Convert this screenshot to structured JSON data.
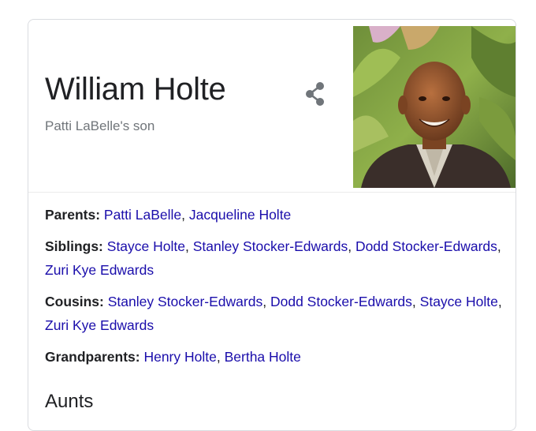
{
  "card": {
    "title": "William Holte",
    "subtitle": "Patti LaBelle's son",
    "share_icon": "share-icon",
    "photo_alt": "William Holte photo"
  },
  "facts": {
    "parents": {
      "label": "Parents:",
      "links": [
        "Patti LaBelle",
        "Jacqueline Holte"
      ]
    },
    "siblings": {
      "label": "Siblings:",
      "links": [
        "Stayce Holte",
        "Stanley Stocker-Edwards",
        "Dodd Stocker-Edwards",
        "Zuri Kye Edwards"
      ]
    },
    "cousins": {
      "label": "Cousins:",
      "links": [
        "Stanley Stocker-Edwards",
        "Dodd Stocker-Edwards",
        "Stayce Holte",
        "Zuri Kye Edwards"
      ]
    },
    "grandparents": {
      "label": "Grandparents:",
      "links": [
        "Henry Holte",
        "Bertha Holte"
      ]
    }
  },
  "section": {
    "aunts_title": "Aunts"
  },
  "colors": {
    "link": "#1a0dab",
    "title": "#202124",
    "subtitle": "#70757a",
    "border": "#dadce0"
  }
}
